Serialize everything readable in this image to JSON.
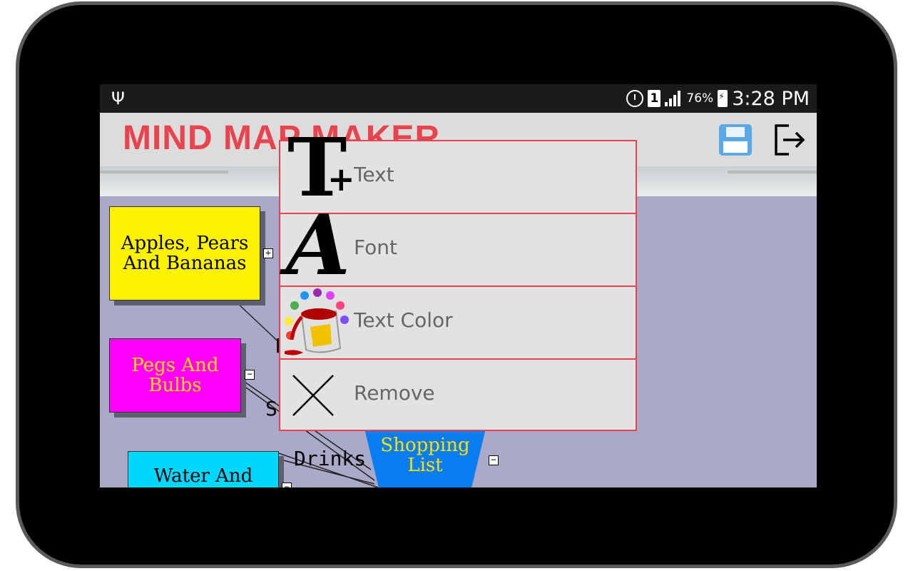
{
  "status_bar": {
    "usb_icon": "usb-icon",
    "alarm_icon": "alarm-icon",
    "sim_label": "1",
    "battery_percent": "76%",
    "time": "3:28 PM"
  },
  "app": {
    "title": "MIND MAP MAKER",
    "save_icon": "save-icon",
    "exit_icon": "exit-icon",
    "accent_color": "#e8444f"
  },
  "mindmap": {
    "nodes": [
      {
        "id": "apples",
        "label": "Apples, Pears And Bananas",
        "color": "#fff200",
        "toggle": "+"
      },
      {
        "id": "pegs",
        "label": "Pegs And Bulbs",
        "color": "#ff00ff",
        "toggle": "−"
      },
      {
        "id": "water",
        "label": "Water And",
        "color": "#00d7ff",
        "toggle": "−"
      },
      {
        "id": "shopping",
        "label": "Shopping List",
        "color": "#0a7ef0",
        "toggle": "−"
      }
    ],
    "edge_labels": {
      "fruit_partial": "F",
      "stationery_partial": "S",
      "drinks": "Drinks"
    }
  },
  "context_menu": {
    "items": [
      {
        "label": "Text",
        "icon": "text-add-icon"
      },
      {
        "label": "Font",
        "icon": "font-icon"
      },
      {
        "label": "Text Color",
        "icon": "paint-bucket-icon"
      },
      {
        "label": "Remove",
        "icon": "close-icon"
      }
    ]
  }
}
